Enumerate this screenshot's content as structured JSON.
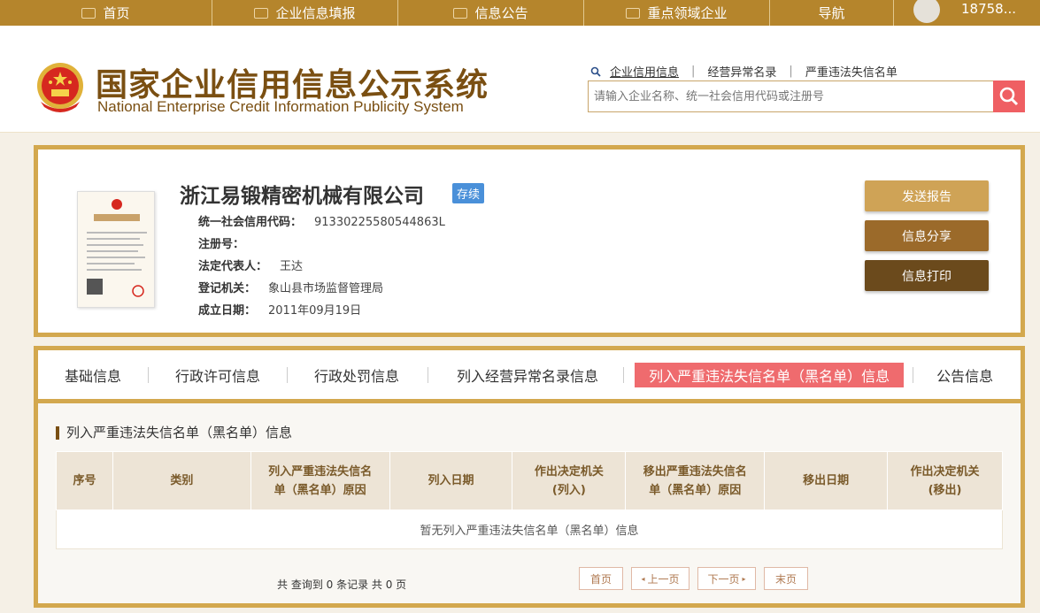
{
  "nav": {
    "items": [
      "首页",
      "企业信息填报",
      "信息公告",
      "重点领域企业",
      "导航"
    ],
    "user": "18758..."
  },
  "header": {
    "title_cn": "国家企业信用信息公示系统",
    "title_en": "National Enterprise Credit Information Publicity System",
    "search_tabs": [
      "企业信用信息",
      "经营异常名录",
      "严重违法失信名单"
    ],
    "search_placeholder": "请输入企业名称、统一社会信用代码或注册号"
  },
  "company": {
    "name": "浙江易锻精密机械有限公司",
    "status": "存续",
    "fields": [
      {
        "label": "统一社会信用代码：",
        "value": "91330225580544863L"
      },
      {
        "label": "注册号：",
        "value": ""
      },
      {
        "label": "法定代表人：",
        "value": "王达"
      },
      {
        "label": "登记机关：",
        "value": "象山县市场监督管理局"
      },
      {
        "label": "成立日期：",
        "value": "2011年09月19日"
      }
    ],
    "actions": [
      "发送报告",
      "信息分享",
      "信息打印"
    ],
    "action_colors": [
      "#cfa356",
      "#9b6a2a",
      "#6b4a1c"
    ]
  },
  "tabs": {
    "items": [
      "基础信息",
      "行政许可信息",
      "行政处罚信息",
      "列入经营异常名录信息",
      "列入严重违法失信名单（黑名单）信息",
      "公告信息"
    ],
    "active_index": 4
  },
  "section": {
    "title": "列入严重违法失信名单（黑名单）信息",
    "columns": [
      "序号",
      "类别",
      "列入严重违法失信名单（黑名单）原因",
      "列入日期",
      "作出决定机关(列入)",
      "移出严重违法失信名单（黑名单）原因",
      "移出日期",
      "作出决定机关(移出)"
    ],
    "empty_text": "暂无列入严重违法失信名单（黑名单）信息"
  },
  "pager": {
    "info": "共 查询到 0 条记录 共 0 页",
    "first": "首页",
    "prev": "上一页",
    "next": "下一页",
    "last": "末页"
  },
  "colors": {
    "nav_bg": "#b5852c",
    "border_gold": "#d3a84e",
    "title_brown": "#7a4f12",
    "active_tab": "#ef6b6e",
    "search_btn": "#ef5f63",
    "status_badge": "#4a90d9"
  }
}
